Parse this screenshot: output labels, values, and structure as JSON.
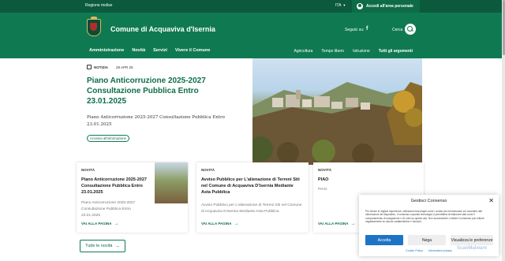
{
  "topbar": {
    "region": "Regione molise",
    "lang": "ITA",
    "access_label": "Accedi all'area personale"
  },
  "header": {
    "site_title": "Comune di Acquaviva d'Isernia",
    "social_label": "Seguici su:",
    "search_label": "Cerca",
    "nav": [
      "Amministrazione",
      "Novità",
      "Servizi",
      "Vivere il Comune"
    ],
    "topics": [
      "Agricoltura",
      "Tempo libero",
      "Istruzione",
      "Tutti gli argomenti"
    ]
  },
  "hero": {
    "category": "NOTIZIA",
    "date": "28 APR 25",
    "title": "Piano Anticorruzione 2025-2027 Consultazione Pubblica Entro 23.01.2025",
    "description": "Piano Anticorruzione 2025-2027 Consultazione Pubblica Entro 23.01.2025",
    "tag": "Accesso all'informazione"
  },
  "cards": [
    {
      "category": "NOVITÀ",
      "title": "Piano Anticorruzione 2025-2027 Consultazione Pubblica Entro 23.01.2025",
      "description": "Piano Anticorruzione 2025-2027 Consultazione Pubblica Entro 23.01.2025",
      "more": "VAI ALLA PAGINA"
    },
    {
      "category": "NOVITÀ",
      "title": "Avviso Pubblico per L'alienazione di Terreni Siti nel Comune di Acquaviva D'Isernia Mediante Asta Pubblica",
      "description": "Avviso Pubblico per L'alienazione di Terreni Siti nel Comune di Acquaviva D'Isernia Mediante Asta Pubblica",
      "more": "VAI ALLA PAGINA"
    },
    {
      "category": "NOVITÀ",
      "title": "PIAO",
      "description": "PIAO",
      "more": "VAI ALLA PAGINA"
    }
  ],
  "all_news_label": "Tutte le novità",
  "consent": {
    "title": "Gestisci Consenso",
    "body": "Per fornire le migliori esperienze, utilizziamo tecnologie come i cookie per memorizzare e/o accedere alle informazioni del dispositivo. Il consenso a queste tecnologie ci permetterà di elaborare dati come il comportamento di navigazione o ID unici su questo sito. Non acconsentire o ritirare il consenso può influire negativamente su alcune caratteristiche e funzioni.",
    "accept": "Accetta",
    "deny": "Nega",
    "preferences": "Visualizza le preferenze",
    "cookie_policy": "Cookie Policy",
    "privacy": "Informativa privacy"
  },
  "watermark": "ScanMalware",
  "colors": {
    "primary": "#0f7a52",
    "dark": "#0b5a3d",
    "accept": "#1e74c4"
  }
}
